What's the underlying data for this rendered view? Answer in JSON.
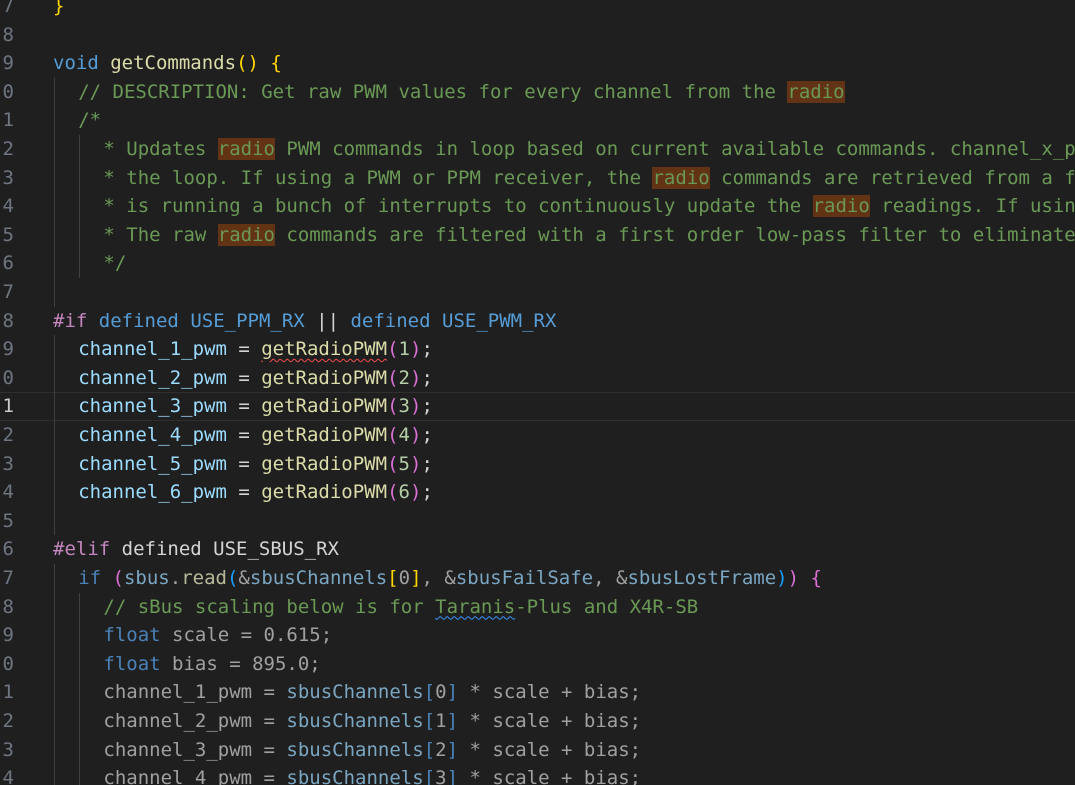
{
  "editor": {
    "current_line_index": 14,
    "lines": [
      {
        "ln": "7",
        "indent": 0,
        "tokens": [
          {
            "t": "}",
            "c": "br1"
          }
        ]
      },
      {
        "ln": "8",
        "indent": 0,
        "tokens": []
      },
      {
        "ln": "9",
        "indent": 0,
        "tokens": [
          {
            "t": "void",
            "c": "kw"
          },
          {
            "t": " ",
            "c": "plain"
          },
          {
            "t": "getCommands",
            "c": "fn"
          },
          {
            "t": "()",
            "c": "br1"
          },
          {
            "t": " ",
            "c": "plain"
          },
          {
            "t": "{",
            "c": "br1"
          }
        ]
      },
      {
        "ln": "0",
        "indent": 1,
        "tokens": [
          {
            "t": "// DESCRIPTION: Get raw PWM values for every channel from the ",
            "c": "cm"
          },
          {
            "t": "radio",
            "c": "cm hl"
          }
        ]
      },
      {
        "ln": "1",
        "indent": 1,
        "tokens": [
          {
            "t": "/*",
            "c": "cm"
          }
        ]
      },
      {
        "ln": "2",
        "indent": 2,
        "tokens": [
          {
            "t": "* Updates ",
            "c": "cm"
          },
          {
            "t": "radio",
            "c": "cm hl"
          },
          {
            "t": " PWM commands in loop based on current available commands. channel_x_pwm is the raw command used in",
            "c": "cm"
          }
        ]
      },
      {
        "ln": "3",
        "indent": 2,
        "tokens": [
          {
            "t": "* the loop. If using a PWM or PPM receiver, the ",
            "c": "cm"
          },
          {
            "t": "radio",
            "c": "cm hl"
          },
          {
            "t": " commands are retrieved from a function in the readPWM file which",
            "c": "cm"
          }
        ]
      },
      {
        "ln": "4",
        "indent": 2,
        "tokens": [
          {
            "t": "* is running a bunch of interrupts to continuously update the ",
            "c": "cm"
          },
          {
            "t": "radio",
            "c": "cm hl"
          },
          {
            "t": " readings. If using an SBUS receiver, the",
            "c": "cm"
          }
        ]
      },
      {
        "ln": "5",
        "indent": 2,
        "tokens": [
          {
            "t": "* The raw ",
            "c": "cm"
          },
          {
            "t": "radio",
            "c": "cm hl"
          },
          {
            "t": " commands are filtered with a first order low-pass filter to eliminate any really high frequency noise.",
            "c": "cm"
          }
        ]
      },
      {
        "ln": "6",
        "indent": 2,
        "tokens": [
          {
            "t": "*/",
            "c": "cm"
          }
        ]
      },
      {
        "ln": "7",
        "indent": 1,
        "tokens": []
      },
      {
        "ln": "8",
        "indent": 0,
        "tokens": [
          {
            "t": "#if",
            "c": "pp"
          },
          {
            "t": " ",
            "c": "plain"
          },
          {
            "t": "defined",
            "c": "kw"
          },
          {
            "t": " ",
            "c": "plain"
          },
          {
            "t": "USE_PPM_RX",
            "c": "kw"
          },
          {
            "t": " || ",
            "c": "plain"
          },
          {
            "t": "defined",
            "c": "kw"
          },
          {
            "t": " ",
            "c": "plain"
          },
          {
            "t": "USE_PWM_RX",
            "c": "kw"
          }
        ]
      },
      {
        "ln": "9",
        "indent": 1,
        "tokens": [
          {
            "t": "channel_1_pwm",
            "c": "var"
          },
          {
            "t": " = ",
            "c": "plain"
          },
          {
            "t": "getRadioPWM",
            "c": "fn sq-red"
          },
          {
            "t": "(",
            "c": "br2"
          },
          {
            "t": "1",
            "c": "num"
          },
          {
            "t": ")",
            "c": "br2"
          },
          {
            "t": ";",
            "c": "plain"
          }
        ]
      },
      {
        "ln": "0",
        "indent": 1,
        "tokens": [
          {
            "t": "channel_2_pwm",
            "c": "var"
          },
          {
            "t": " = ",
            "c": "plain"
          },
          {
            "t": "getRadioPWM",
            "c": "fn"
          },
          {
            "t": "(",
            "c": "br2"
          },
          {
            "t": "2",
            "c": "num"
          },
          {
            "t": ")",
            "c": "br2"
          },
          {
            "t": ";",
            "c": "plain"
          }
        ]
      },
      {
        "ln": "1",
        "indent": 1,
        "tokens": [
          {
            "t": "channel_3_pwm",
            "c": "var"
          },
          {
            "t": " = ",
            "c": "plain"
          },
          {
            "t": "getRadioPWM",
            "c": "fn"
          },
          {
            "t": "(",
            "c": "br2"
          },
          {
            "t": "3",
            "c": "num"
          },
          {
            "t": ")",
            "c": "br2"
          },
          {
            "t": ";",
            "c": "plain"
          }
        ]
      },
      {
        "ln": "2",
        "indent": 1,
        "tokens": [
          {
            "t": "channel_4_pwm",
            "c": "var"
          },
          {
            "t": " = ",
            "c": "plain"
          },
          {
            "t": "getRadioPWM",
            "c": "fn"
          },
          {
            "t": "(",
            "c": "br2"
          },
          {
            "t": "4",
            "c": "num"
          },
          {
            "t": ")",
            "c": "br2"
          },
          {
            "t": ";",
            "c": "plain"
          }
        ]
      },
      {
        "ln": "3",
        "indent": 1,
        "tokens": [
          {
            "t": "channel_5_pwm",
            "c": "var"
          },
          {
            "t": " = ",
            "c": "plain"
          },
          {
            "t": "getRadioPWM",
            "c": "fn"
          },
          {
            "t": "(",
            "c": "br2"
          },
          {
            "t": "5",
            "c": "num"
          },
          {
            "t": ")",
            "c": "br2"
          },
          {
            "t": ";",
            "c": "plain"
          }
        ]
      },
      {
        "ln": "4",
        "indent": 1,
        "tokens": [
          {
            "t": "channel_6_pwm",
            "c": "var"
          },
          {
            "t": " = ",
            "c": "plain"
          },
          {
            "t": "getRadioPWM",
            "c": "fn"
          },
          {
            "t": "(",
            "c": "br2"
          },
          {
            "t": "6",
            "c": "num"
          },
          {
            "t": ")",
            "c": "br2"
          },
          {
            "t": ";",
            "c": "plain"
          }
        ]
      },
      {
        "ln": "5",
        "indent": 1,
        "tokens": []
      },
      {
        "ln": "6",
        "indent": 0,
        "tokens": [
          {
            "t": "#elif",
            "c": "pp"
          },
          {
            "t": " defined USE_SBUS_RX",
            "c": "plain"
          }
        ]
      },
      {
        "ln": "7",
        "indent": 1,
        "tokens": [
          {
            "t": "if",
            "c": "dimkw"
          },
          {
            "t": " ",
            "c": "dim"
          },
          {
            "t": "(",
            "c": "br2"
          },
          {
            "t": "sbus",
            "c": "dimvar"
          },
          {
            "t": ".",
            "c": "dim"
          },
          {
            "t": "read",
            "c": "dimfn"
          },
          {
            "t": "(",
            "c": "br3"
          },
          {
            "t": "&",
            "c": "dim"
          },
          {
            "t": "sbusChannels",
            "c": "dimvar"
          },
          {
            "t": "[",
            "c": "br1"
          },
          {
            "t": "0",
            "c": "dim"
          },
          {
            "t": "]",
            "c": "br1"
          },
          {
            "t": ", &",
            "c": "dim"
          },
          {
            "t": "sbusFailSafe",
            "c": "dimvar"
          },
          {
            "t": ", &",
            "c": "dim"
          },
          {
            "t": "sbusLostFrame",
            "c": "dimvar"
          },
          {
            "t": ")",
            "c": "br3"
          },
          {
            "t": ")",
            "c": "br2"
          },
          {
            "t": " ",
            "c": "dim"
          },
          {
            "t": "{",
            "c": "br2"
          }
        ]
      },
      {
        "ln": "8",
        "indent": 2,
        "tokens": [
          {
            "t": "// sBus scaling below is for ",
            "c": "cm"
          },
          {
            "t": "Taranis",
            "c": "cm sq-blue"
          },
          {
            "t": "-Plus and X4R-SB",
            "c": "cm"
          }
        ]
      },
      {
        "ln": "9",
        "indent": 2,
        "tokens": [
          {
            "t": "float",
            "c": "dimkw"
          },
          {
            "t": " scale = 0.615;",
            "c": "dim"
          }
        ]
      },
      {
        "ln": "0",
        "indent": 2,
        "tokens": [
          {
            "t": "float",
            "c": "dimkw"
          },
          {
            "t": " bias = 895.0;",
            "c": "dim"
          }
        ]
      },
      {
        "ln": "1",
        "indent": 2,
        "tokens": [
          {
            "t": "channel_1_pwm = ",
            "c": "dim"
          },
          {
            "t": "sbusChannels",
            "c": "dimvar"
          },
          {
            "t": "[",
            "c": "dimkw"
          },
          {
            "t": "0",
            "c": "dim"
          },
          {
            "t": "]",
            "c": "dimkw"
          },
          {
            "t": " * scale + bias;",
            "c": "dim"
          }
        ]
      },
      {
        "ln": "2",
        "indent": 2,
        "tokens": [
          {
            "t": "channel_2_pwm = ",
            "c": "dim"
          },
          {
            "t": "sbusChannels",
            "c": "dimvar"
          },
          {
            "t": "[",
            "c": "dimkw"
          },
          {
            "t": "1",
            "c": "dim"
          },
          {
            "t": "]",
            "c": "dimkw"
          },
          {
            "t": " * scale + bias;",
            "c": "dim"
          }
        ]
      },
      {
        "ln": "3",
        "indent": 2,
        "tokens": [
          {
            "t": "channel_3_pwm = ",
            "c": "dim"
          },
          {
            "t": "sbusChannels",
            "c": "dimvar"
          },
          {
            "t": "[",
            "c": "dimkw"
          },
          {
            "t": "2",
            "c": "dim"
          },
          {
            "t": "]",
            "c": "dimkw"
          },
          {
            "t": " * scale + bias;",
            "c": "dim"
          }
        ]
      },
      {
        "ln": "4",
        "indent": 2,
        "tokens": [
          {
            "t": "channel_4_pwm = ",
            "c": "dim"
          },
          {
            "t": "sbusChannels",
            "c": "dimvar"
          },
          {
            "t": "[",
            "c": "dimkw"
          },
          {
            "t": "3",
            "c": "dim"
          },
          {
            "t": "]",
            "c": "dimkw"
          },
          {
            "t": " * scale + bias;",
            "c": "dim"
          }
        ]
      }
    ]
  }
}
